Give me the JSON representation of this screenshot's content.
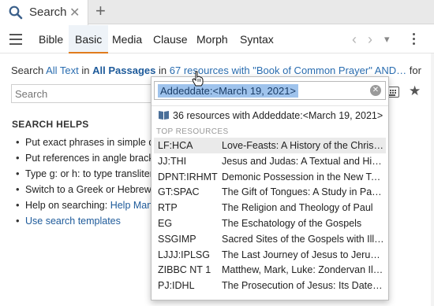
{
  "tab": {
    "label": "Search",
    "close_glyph": "✕",
    "new_glyph": "+"
  },
  "toolbar": {
    "tabs": [
      "Bible",
      "Basic",
      "Media",
      "Clause",
      "Morph",
      "Syntax"
    ],
    "active_tab": "Basic",
    "back_glyph": "‹",
    "forward_glyph": "›",
    "menu_glyph": "▾"
  },
  "search_line": {
    "prefix": "Search",
    "scope": "All Text",
    "in1": "in",
    "passages": "All Passages",
    "in2": "in",
    "resources": "67 resources with \"Book of Common Prayer\" AND…",
    "suffix": "for"
  },
  "search": {
    "placeholder": "Search"
  },
  "helps": {
    "title": "SEARCH HELPS",
    "items": [
      "Put exact phrases in simple qu",
      "Put references in angle bracket",
      "Type g: or h: to type translitera",
      "Switch to a Greek or Hebrew ke",
      "Help on searching: ",
      "Use search templates"
    ],
    "help_link": "Help Manua"
  },
  "dropdown": {
    "query": "Addeddate:<March 19, 2021>",
    "count_text": "36 resources with Addeddate:<March 19, 2021>",
    "section": "TOP RESOURCES",
    "rows": [
      {
        "abbr": "LF:HCA",
        "title": "Love-Feasts: A History of the Christ…"
      },
      {
        "abbr": "JJ:THI",
        "title": "Jesus and Judas: A Textual and His…"
      },
      {
        "abbr": "DPNT:IRHMT",
        "title": "Demonic Possession in the New Te…"
      },
      {
        "abbr": "GT:SPAC",
        "title": "The Gift of Tongues: A Study in Pat…"
      },
      {
        "abbr": "RTP",
        "title": "The Religion and Theology of Paul"
      },
      {
        "abbr": "EG",
        "title": "The Eschatology of the Gospels"
      },
      {
        "abbr": "SSGIMP",
        "title": "Sacred Sites of the Gospels with Ill…"
      },
      {
        "abbr": "LJJJ:IPLSG",
        "title": "The Last Journey of Jesus to Jerus…"
      },
      {
        "abbr": "ZIBBC NT 1",
        "title": "Matthew, Mark, Luke: Zondervan Il…"
      },
      {
        "abbr": "PJ:IDHL",
        "title": "The Prosecution of Jesus: Its Date,…"
      }
    ]
  },
  "icons": {
    "tab": "search-icon",
    "menu": "hamburger-icon",
    "keyboard": "keyboard-icon",
    "favorite": "star-icon",
    "resources": "book-icon",
    "clear": "clear-icon",
    "more": "more-vertical-icon"
  },
  "colors": {
    "link": "#2a6db0",
    "active_tab_underline": "#e07b1c",
    "selection": "#9fc3ec",
    "row_highlight": "#eaeaea"
  }
}
